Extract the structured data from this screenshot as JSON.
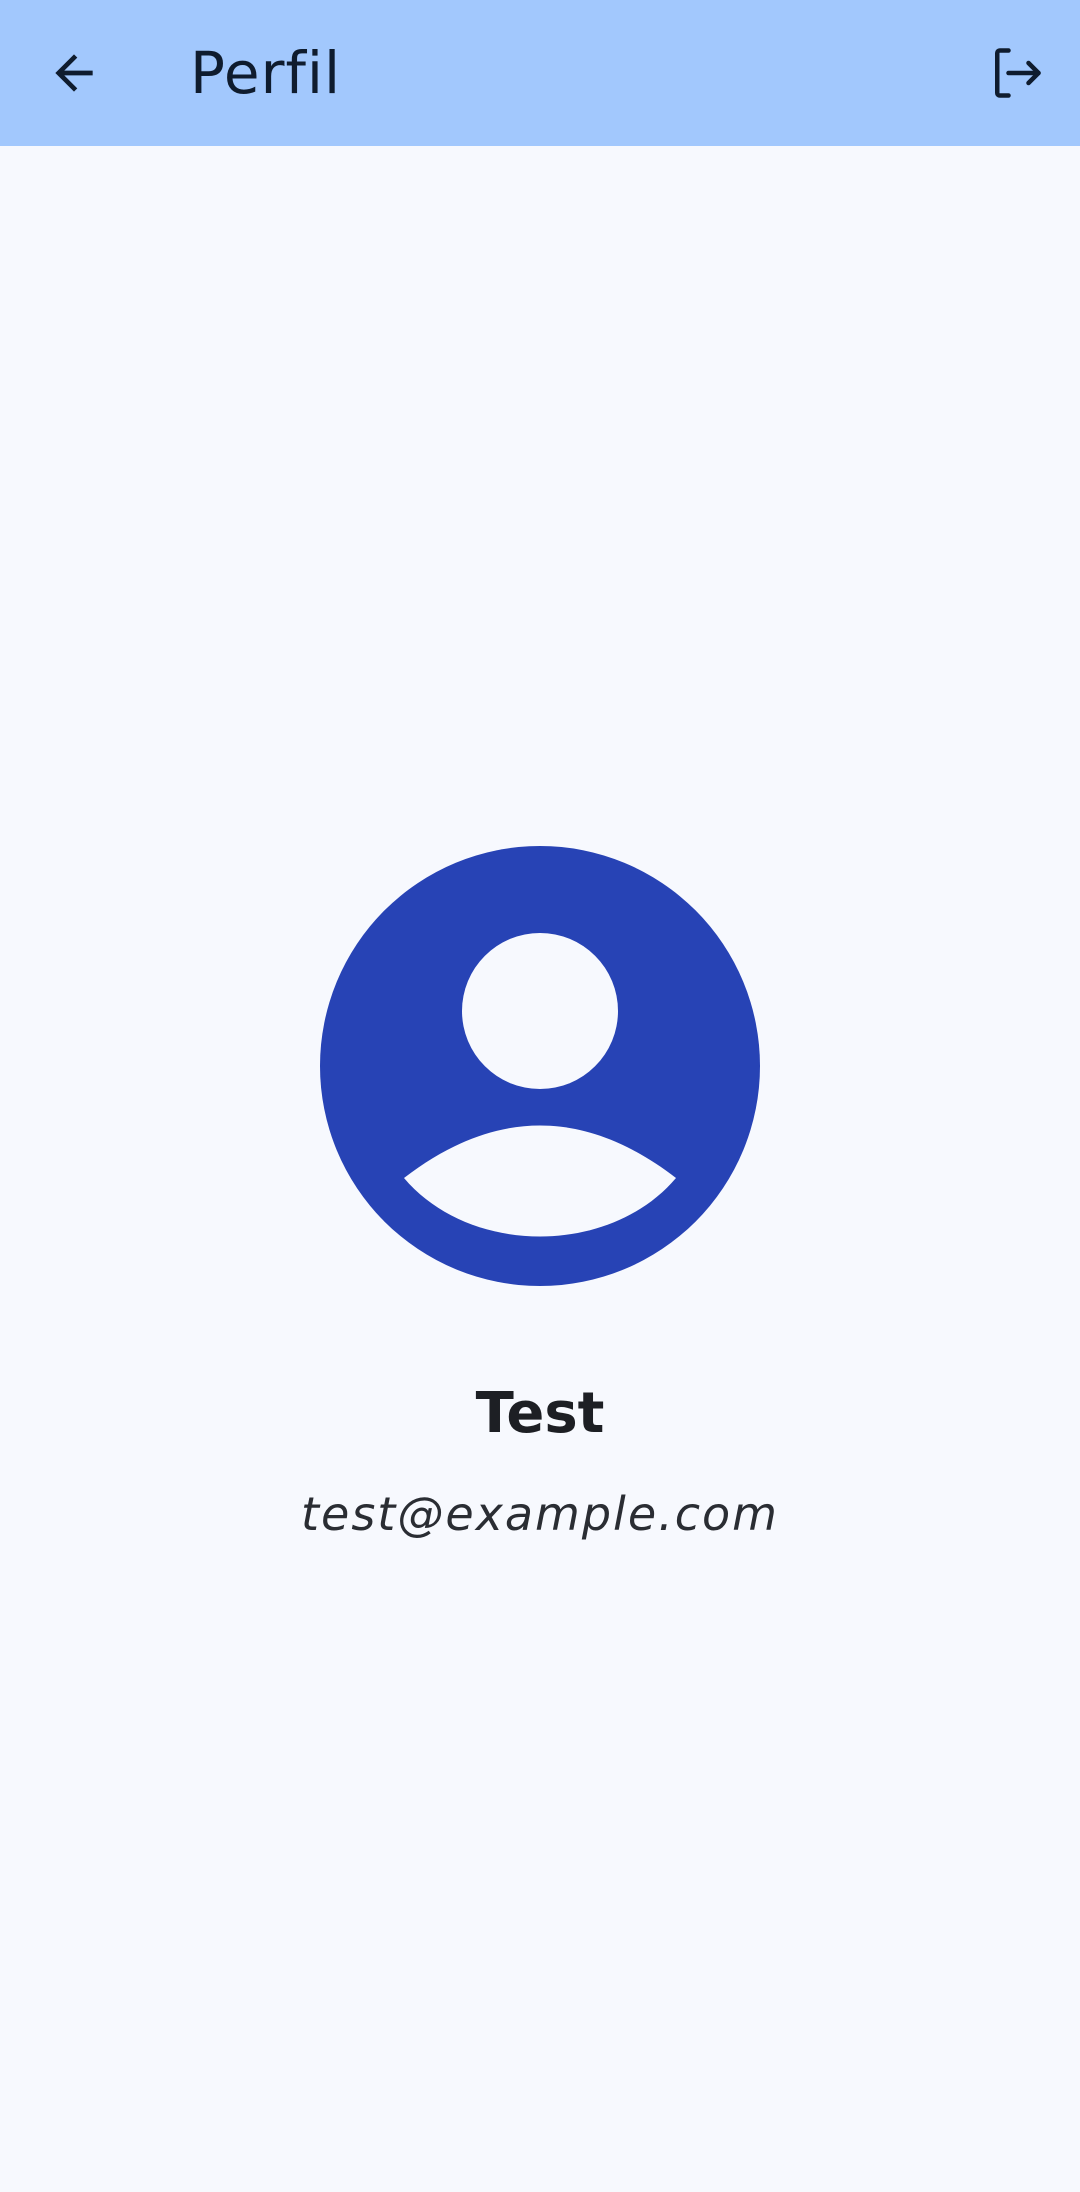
{
  "header": {
    "title": "Perfil",
    "back_icon": "arrow-left-icon",
    "logout_icon": "logout-icon"
  },
  "profile": {
    "avatar_icon": "account-circle-icon",
    "name": "Test",
    "email": "test@example.com"
  },
  "colors": {
    "app_bar": "#a2c8fd",
    "background": "#f7f9fe",
    "avatar": "#2743b5"
  }
}
